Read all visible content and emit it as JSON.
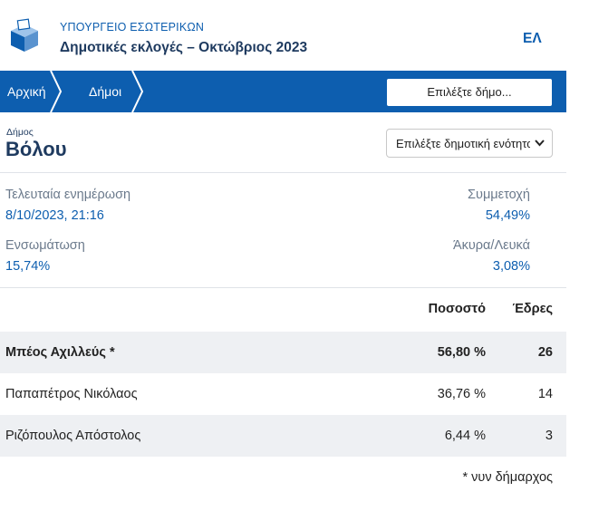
{
  "header": {
    "ministry": "ΥΠΟΥΡΓΕΙΟ ΕΣΩΤΕΡΙΚΩΝ",
    "election_title": "Δημοτικές εκλογές – Οκτώβριος 2023",
    "language": "ΕΛ",
    "logo_icon": "ballot-box-icon"
  },
  "navbar": {
    "breadcrumbs": [
      "Αρχική",
      "Δήμοι"
    ],
    "select_municipality": "Επιλέξτε δήμο..."
  },
  "municipality": {
    "label": "Δήμος",
    "name": "Βόλου",
    "unit_select": "Επιλέξτε δημοτική ενότητα"
  },
  "stats": {
    "last_update_label": "Τελευταία ενημέρωση",
    "last_update_value": "8/10/2023, 21:16",
    "turnout_label": "Συμμετοχή",
    "turnout_value": "54,49%",
    "integration_label": "Ενσωμάτωση",
    "integration_value": "15,74%",
    "invalid_label": "Άκυρα/Λευκά",
    "invalid_value": "3,08%"
  },
  "table": {
    "headers": {
      "percent": "Ποσοστό",
      "seats": "Έδρες"
    },
    "rows": [
      {
        "candidate": "Μπέος Αχιλλεύς *",
        "percent": "56,80 %",
        "seats": "26"
      },
      {
        "candidate": "Παπαπέτρος Νικόλαος",
        "percent": "36,76 %",
        "seats": "14"
      },
      {
        "candidate": "Ριζόπουλος Απόστολος",
        "percent": "6,44 %",
        "seats": "3"
      }
    ],
    "footnote": "* νυν δήμαρχος"
  },
  "colors": {
    "primary": "#0d5eaf",
    "title_dark": "#1e3a5f",
    "row_shade": "#eef0f3"
  }
}
